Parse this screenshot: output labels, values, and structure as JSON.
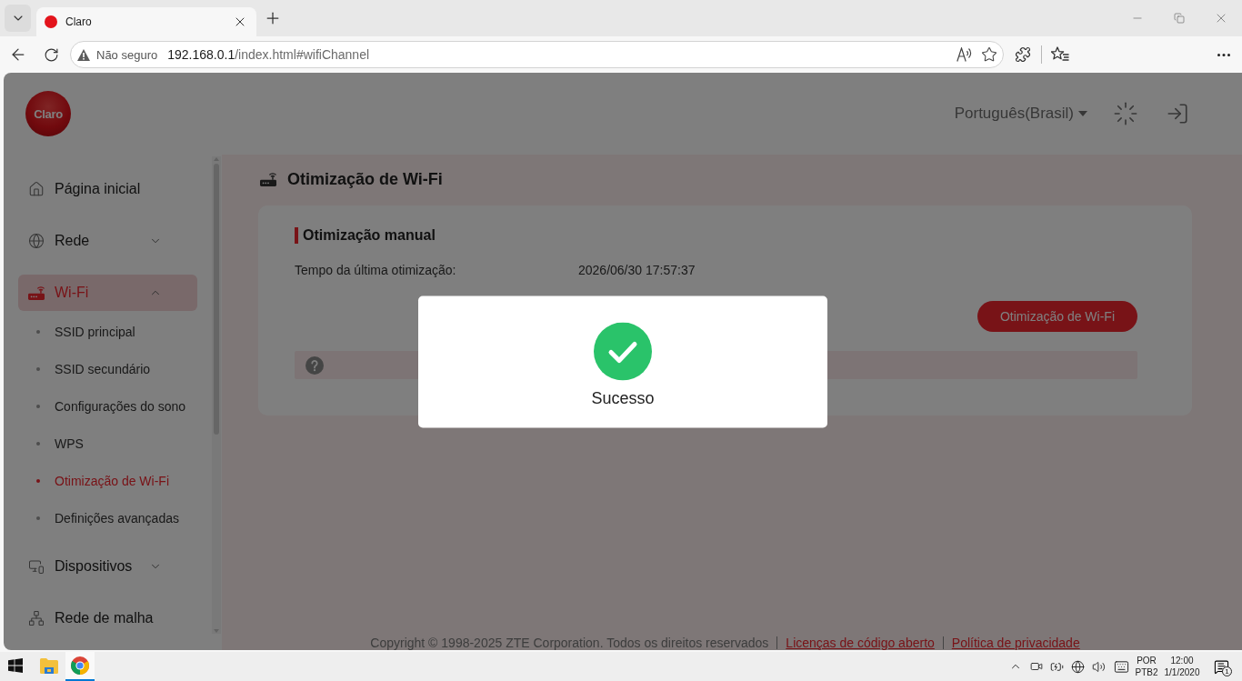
{
  "browser": {
    "tabs": [
      {
        "title": "Claro",
        "selected": true
      }
    ],
    "address_bar": {
      "security": "Não seguro",
      "host": "192.168.0.1",
      "path": "/index.html#wifiChannel"
    }
  },
  "header": {
    "logo_text": "Claro",
    "language": "Português(Brasil)"
  },
  "sidebar": {
    "items": [
      {
        "kind": "link",
        "label": "Página inicial",
        "selected": false
      },
      {
        "kind": "group",
        "label": "Rede",
        "selected": false,
        "expanded": false
      },
      {
        "kind": "group",
        "label": "Wi-Fi",
        "selected": true,
        "expanded": true,
        "children": [
          {
            "label": "SSID principal",
            "selected": false
          },
          {
            "label": "SSID secundário",
            "selected": false
          },
          {
            "label": "Configurações do sono",
            "selected": false
          },
          {
            "label": "WPS",
            "selected": false
          },
          {
            "label": "Otimização de Wi-Fi",
            "selected": true
          },
          {
            "label": "Definições avançadas",
            "selected": false
          }
        ]
      },
      {
        "kind": "group",
        "label": "Dispositivos",
        "selected": false,
        "expanded": false
      },
      {
        "kind": "link",
        "label": "Rede de malha",
        "selected": false
      }
    ]
  },
  "main": {
    "title": "Otimização de Wi-Fi",
    "card": {
      "section_title": "Otimização manual",
      "fields": [
        {
          "label": "Tempo da última otimização:",
          "value": "2026/06/30 17:57:37"
        }
      ],
      "action_button": "Otimização de Wi-Fi"
    }
  },
  "footer": {
    "copyright": "Copyright © 1998-2025 ZTE Corporation. Todos os direitos reservados",
    "links": [
      "Licenças de código aberto",
      "Política de privacidade"
    ]
  },
  "modal": {
    "message": "Sucesso"
  },
  "taskbar": {
    "apps": [
      {
        "selected": false
      },
      {
        "selected": true
      }
    ],
    "input_language": "POR",
    "keyboard_layout": "PTB2",
    "time": "12:00",
    "date": "1/1/2020",
    "notification_count": "1"
  }
}
